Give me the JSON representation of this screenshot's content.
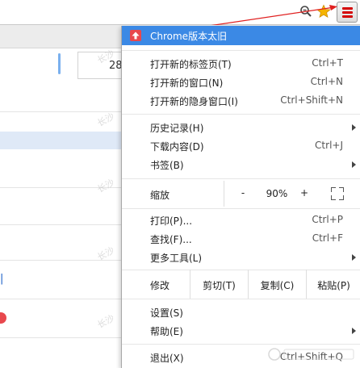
{
  "background": {
    "zoom_input_value": "28"
  },
  "colors": {
    "menu_highlight": "#3b89e5",
    "update_badge": "#e8484d",
    "menu_button_lines": "#d40000",
    "star": "#f5b400"
  },
  "icons": {
    "zoom": "magnifier-minus-icon",
    "bookmark": "star-icon",
    "menu": "hamburger-menu-icon",
    "update": "update-arrow-icon",
    "fullscreen": "fullscreen-icon"
  },
  "menu": {
    "update_item": "Chrome版本太旧",
    "group1": [
      {
        "label": "打开新的标签页(T)",
        "shortcut": "Ctrl+T"
      },
      {
        "label": "打开新的窗口(N)",
        "shortcut": "Ctrl+N"
      },
      {
        "label": "打开新的隐身窗口(I)",
        "shortcut": "Ctrl+Shift+N"
      }
    ],
    "group2": [
      {
        "label": "历史记录(H)",
        "shortcut": ""
      },
      {
        "label": "下载内容(D)",
        "shortcut": "Ctrl+J"
      },
      {
        "label": "书签(B)",
        "shortcut": ""
      }
    ],
    "zoom": {
      "label": "缩放",
      "minus": "-",
      "value": "90%",
      "plus": "+"
    },
    "group3": [
      {
        "label": "打印(P)...",
        "shortcut": "Ctrl+P"
      },
      {
        "label": "查找(F)...",
        "shortcut": "Ctrl+F"
      },
      {
        "label": "更多工具(L)",
        "shortcut": ""
      }
    ],
    "edit": {
      "label": "修改",
      "cut": "剪切(T)",
      "copy": "复制(C)",
      "paste": "粘贴(P)"
    },
    "group4": [
      {
        "label": "设置(S)",
        "shortcut": ""
      },
      {
        "label": "帮助(E)",
        "shortcut": ""
      }
    ],
    "exit": {
      "label": "退出(X)",
      "shortcut": "Ctrl+Shift+Q"
    }
  }
}
